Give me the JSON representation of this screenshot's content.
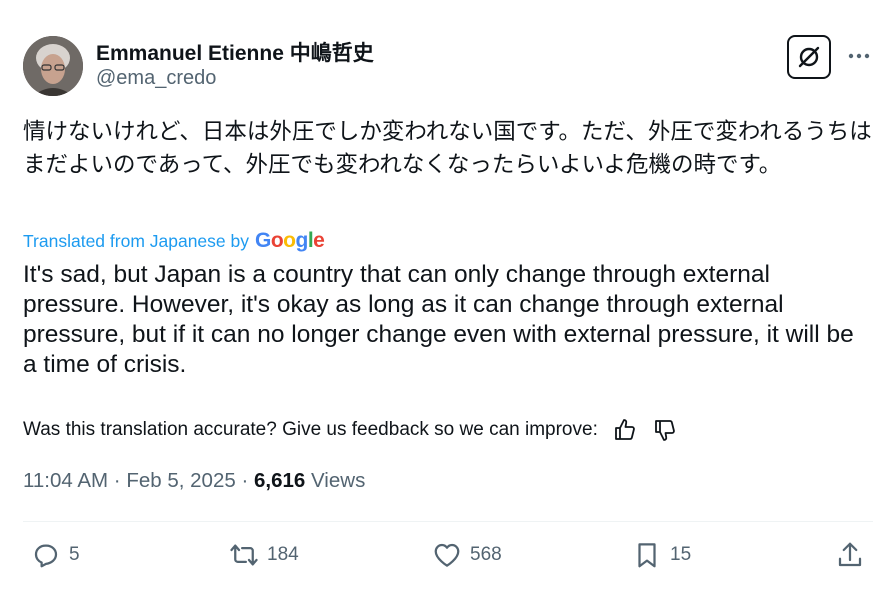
{
  "author": {
    "name": "Emmanuel Etienne 中嶋哲史",
    "handle": "@ema_credo"
  },
  "tweet": {
    "original_text": "情けないけれど、日本は外圧でしか変われない国です。ただ、外圧で変われるうちはまだよいのであって、外圧でも変われなくなったらいよいよ危機の時です。",
    "translated_label": "Translated from Japanese by",
    "translation_provider": "Google",
    "translated_text": "It's sad, but Japan is a country that can only change through external pressure. However, it's okay as long as it can change through external pressure, but if it can no longer change even with external pressure, it will be a time of crisis.",
    "feedback_prompt": "Was this translation accurate? Give us feedback so we can improve:",
    "time": "11:04 AM",
    "date": "Feb 5, 2025",
    "separator": "·",
    "views_count": "6,616",
    "views_label": "Views"
  },
  "actions": {
    "replies": "5",
    "retweets": "184",
    "likes": "568",
    "bookmarks": "15"
  },
  "icons": [
    "grok-icon",
    "more-icon",
    "thumbs-up-icon",
    "thumbs-down-icon",
    "reply-icon",
    "retweet-icon",
    "like-icon",
    "bookmark-icon",
    "share-icon"
  ],
  "colors": {
    "link": "#1d9bf0",
    "secondary_text": "#536471",
    "primary_text": "#0f1419"
  }
}
